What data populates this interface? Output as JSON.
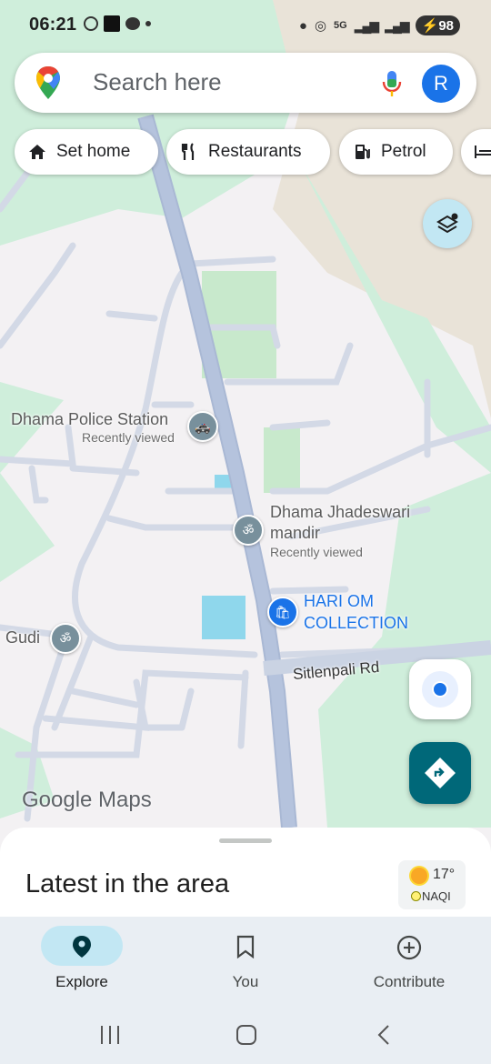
{
  "status_bar": {
    "time": "06:21",
    "network": "5G",
    "battery": "98",
    "icons": [
      "whatsapp-icon",
      "app-icon",
      "message-icon",
      "dot-icon",
      "location-icon",
      "hotspot-icon",
      "signal-icon",
      "battery-icon"
    ]
  },
  "search": {
    "placeholder": "Search here",
    "avatar_letter": "R"
  },
  "chips": [
    {
      "label": "Set home",
      "icon": "home-icon"
    },
    {
      "label": "Restaurants",
      "icon": "restaurant-icon"
    },
    {
      "label": "Petrol",
      "icon": "fuel-icon"
    }
  ],
  "map": {
    "places": {
      "police": {
        "name": "Dhama Police Station",
        "note": "Recently viewed"
      },
      "temple": {
        "name_line1": "Dhama Jhadeswari",
        "name_line2": "mandir",
        "note": "Recently viewed"
      },
      "shop": {
        "name_line1": "HARI OM",
        "name_line2": "COLLECTION"
      },
      "gudi": {
        "name": "Gudi"
      }
    },
    "road_label": "Sitlenpali Rd",
    "logo": "Google Maps",
    "colors": {
      "land": "#f3f1f3",
      "green": "#cfeedb",
      "road": "#a9b8d4",
      "water": "#8fd7ec"
    }
  },
  "sheet": {
    "title": "Latest in the area",
    "weather": {
      "temp": "17°",
      "aqi": "NAQI"
    }
  },
  "nav": {
    "explore": "Explore",
    "you": "You",
    "contribute": "Contribute"
  }
}
